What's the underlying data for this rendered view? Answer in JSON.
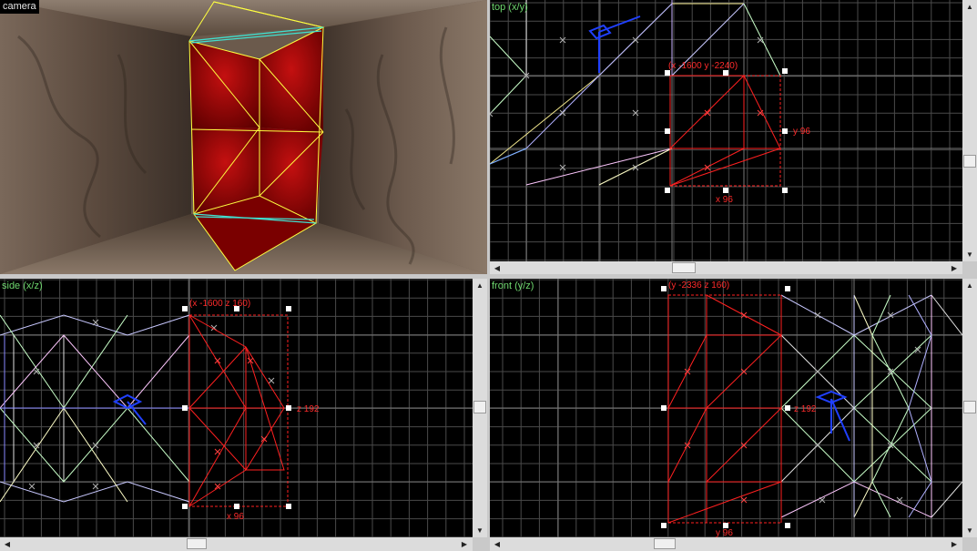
{
  "viewports": {
    "camera": {
      "title": "camera"
    },
    "top": {
      "title": "top (x/y)",
      "coord_label": "(x -1600 y -2240)",
      "dim_y": "y 96",
      "dim_x": "x 96"
    },
    "side": {
      "title": "side (x/z)",
      "coord_label": "(x -1600 z 160)",
      "dim_z": "z 192",
      "dim_x": "x 96"
    },
    "front": {
      "title": "front (y/z)",
      "coord_label": "(y -2336 z 160)",
      "dim_z": "z 192",
      "dim_y": "y 96"
    }
  },
  "colors": {
    "selection": "#ff2020",
    "grid": "#4a4a4a",
    "viewport_title": "#6fd86f",
    "camera_wire": "#ffff40",
    "brush_face": "#8a0000"
  },
  "icons": {
    "scroll_up": "▲",
    "scroll_down": "▼",
    "scroll_left": "◀",
    "scroll_right": "▶"
  }
}
